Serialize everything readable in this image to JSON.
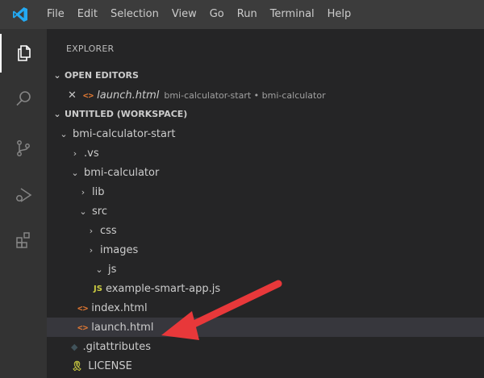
{
  "menu": {
    "items": [
      "File",
      "Edit",
      "Selection",
      "View",
      "Go",
      "Run",
      "Terminal",
      "Help"
    ]
  },
  "activity_bar": {
    "icons": [
      "files-icon",
      "search-icon",
      "source-control-icon",
      "run-debug-icon",
      "extensions-icon"
    ]
  },
  "explorer": {
    "title": "EXPLORER",
    "open_editors": {
      "header": "OPEN EDITORS",
      "file": "launch.html",
      "path": "bmi-calculator-start • bmi-calculator"
    },
    "workspace": {
      "header": "UNTITLED (WORKSPACE)",
      "tree": [
        {
          "label": "bmi-calculator-start",
          "kind": "folder-open"
        },
        {
          "label": ".vs",
          "kind": "folder"
        },
        {
          "label": "bmi-calculator",
          "kind": "folder-open"
        },
        {
          "label": "lib",
          "kind": "folder"
        },
        {
          "label": "src",
          "kind": "folder-open"
        },
        {
          "label": "css",
          "kind": "folder"
        },
        {
          "label": "images",
          "kind": "folder"
        },
        {
          "label": "js",
          "kind": "folder-open"
        },
        {
          "label": "example-smart-app.js",
          "kind": "js"
        },
        {
          "label": "index.html",
          "kind": "html"
        },
        {
          "label": "launch.html",
          "kind": "html"
        },
        {
          "label": ".gitattributes",
          "kind": "git"
        },
        {
          "label": "LICENSE",
          "kind": "license"
        }
      ]
    }
  },
  "colors": {
    "titlebar": "#3c3c3c",
    "activitybar": "#333333",
    "sidebar": "#252526",
    "selection": "#37373d",
    "annotation_arrow": "#e8383a",
    "vscode_blue": "#23a9f2"
  }
}
